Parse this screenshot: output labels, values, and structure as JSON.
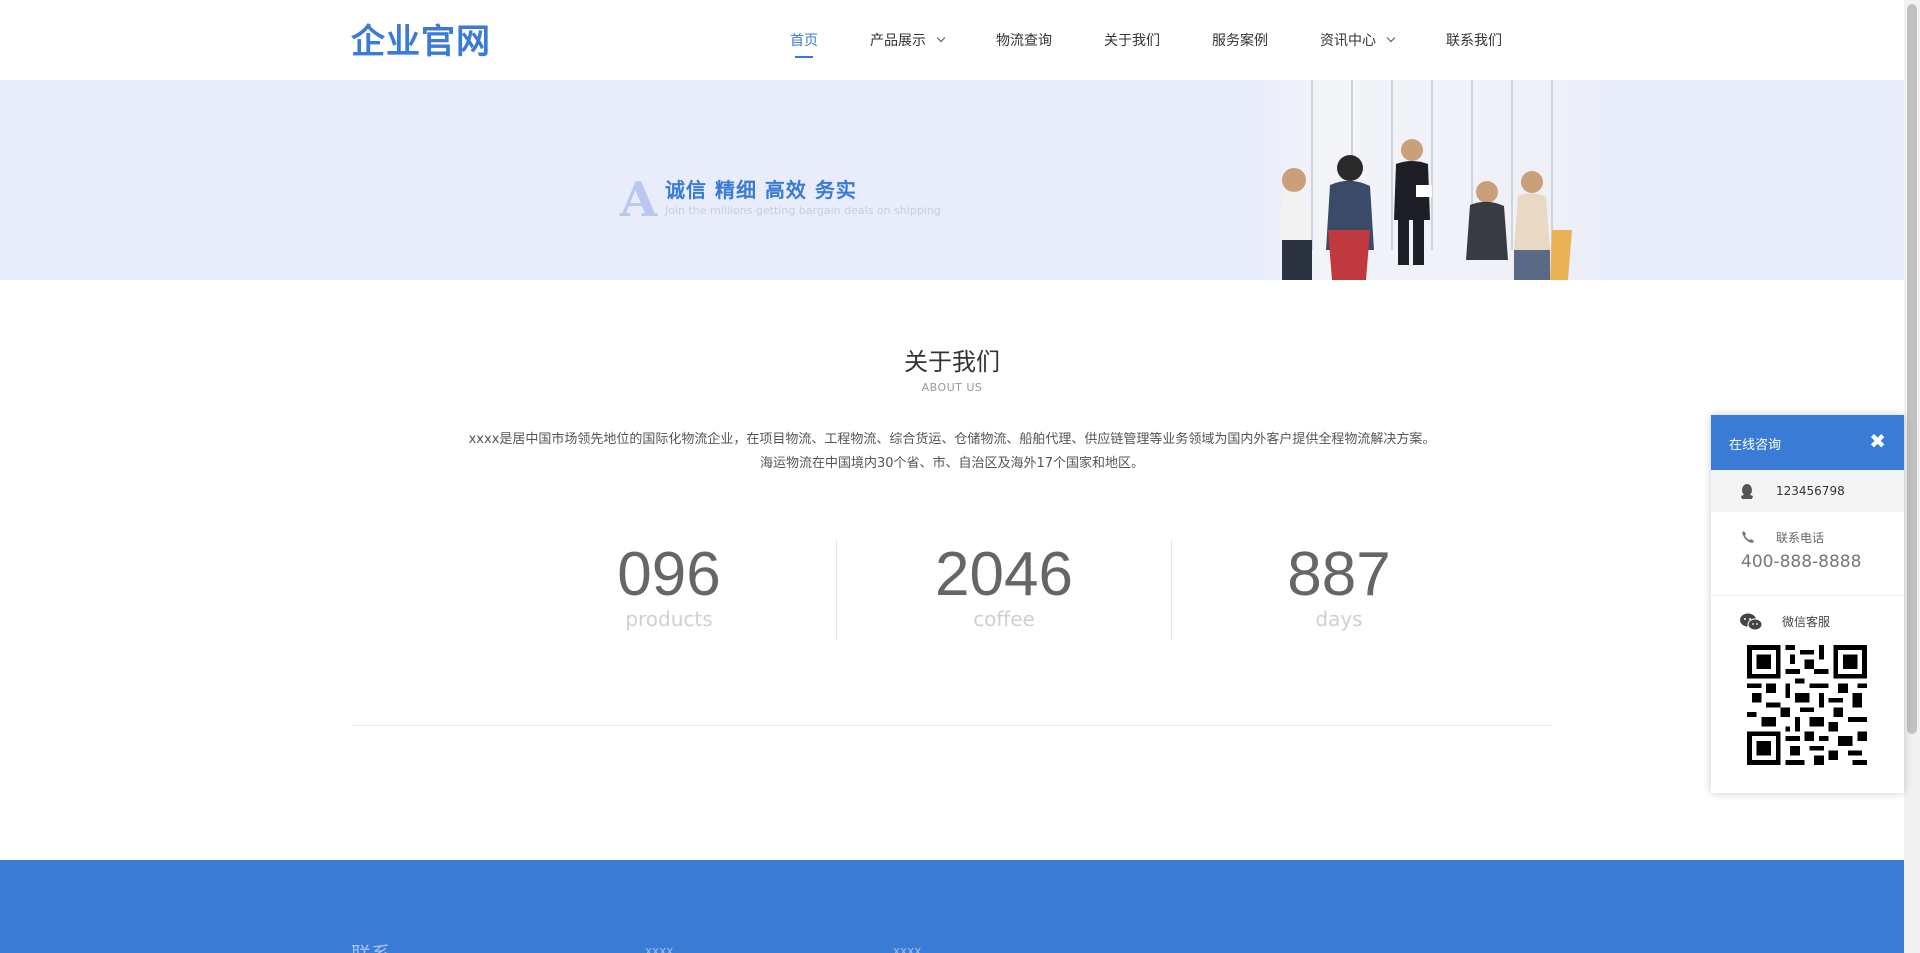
{
  "header": {
    "logo": "企业官网",
    "nav": [
      {
        "label": "首页",
        "active": true,
        "dropdown": false
      },
      {
        "label": "产品展示",
        "active": false,
        "dropdown": true
      },
      {
        "label": "物流查询",
        "active": false,
        "dropdown": false
      },
      {
        "label": "关于我们",
        "active": false,
        "dropdown": false
      },
      {
        "label": "服务案例",
        "active": false,
        "dropdown": false
      },
      {
        "label": "资讯中心",
        "active": false,
        "dropdown": true
      },
      {
        "label": "联系我们",
        "active": false,
        "dropdown": false
      }
    ]
  },
  "banner": {
    "letter": "A",
    "title": "诚信 精细 高效 务实",
    "subtitle": "Join the millions getting bargain deals on shipping"
  },
  "about": {
    "title": "关于我们",
    "subtitle": "ABOUT US",
    "desc_line1": "xxxx是居中国市场领先地位的国际化物流企业，在项目物流、工程物流、综合货运、仓储物流、船舶代理、供应链管理等业务领域为国内外客户提供全程物流解决方案。",
    "desc_line2": "海运物流在中国境内30个省、市、自治区及海外17个国家和地区。"
  },
  "stats": [
    {
      "value": "096",
      "label": "products"
    },
    {
      "value": "2046",
      "label": "coffee"
    },
    {
      "value": "887",
      "label": "days"
    }
  ],
  "footer": {
    "col1": "联系",
    "col2": "xxxx",
    "col3": "xxxx"
  },
  "side_panel": {
    "title": "在线咨询",
    "close": "✖",
    "qq": "123456798",
    "phone_label": "联系电话",
    "phone": "400-888-8888",
    "wechat_label": "微信客服"
  },
  "colors": {
    "accent": "#3a7bd5",
    "banner_bg": "#e8ecfb"
  }
}
